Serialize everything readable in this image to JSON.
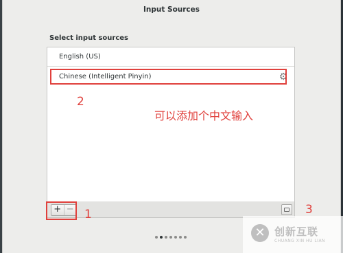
{
  "window": {
    "title": "Input Sources"
  },
  "section": {
    "label": "Select input sources"
  },
  "sources": [
    {
      "label": "English (US)"
    },
    {
      "label": "Chinese (Intelligent Pinyin)",
      "icon": "gear-icon"
    }
  ],
  "toolbar": {
    "add_label": "+",
    "remove_label": "−",
    "keyboard_icon": "keyboard-icon"
  },
  "annotations": {
    "step1": "1",
    "step2": "2",
    "step3": "3",
    "note": "可以添加个中文输入",
    "color": "#e0403c"
  },
  "pager": {
    "total": 7,
    "active": 1
  },
  "watermark": {
    "title": "创新互联",
    "subtitle": "CHUANG XIN HU LIAN",
    "logo_glyph": "✕"
  }
}
